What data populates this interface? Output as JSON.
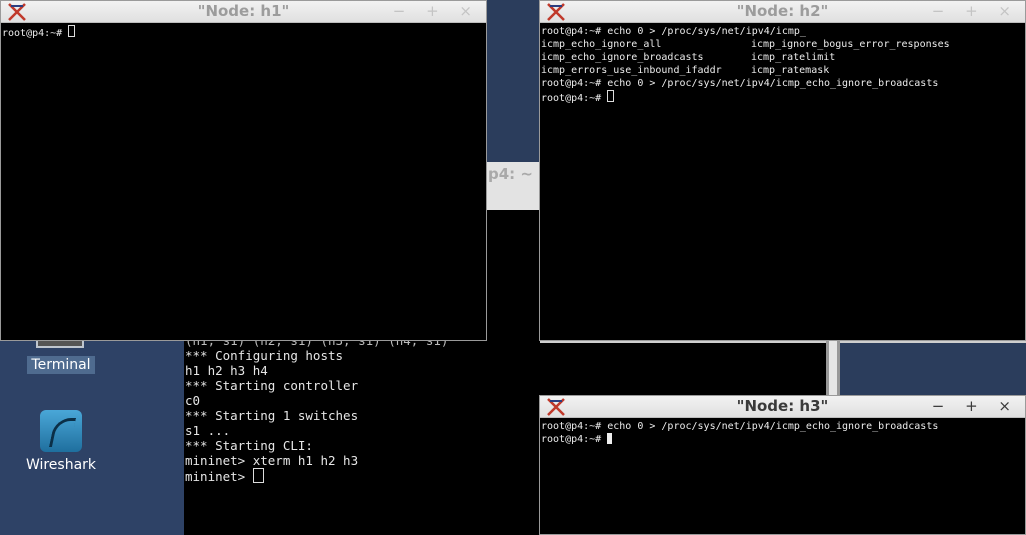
{
  "desktop": {
    "terminal_icon_label": "Terminal",
    "wireshark_icon_label": "Wireshark"
  },
  "background_window": {
    "title_partial": "p4: ~"
  },
  "mininet_terminal": {
    "lines": [
      "(h1, s1) (h2, s1) (h3, s1) (h4, s1)",
      "*** Configuring hosts",
      "h1 h2 h3 h4",
      "*** Starting controller",
      "c0",
      "*** Starting 1 switches",
      "s1 ...",
      "*** Starting CLI:",
      "mininet> xterm h1 h2 h3"
    ],
    "prompt": "mininet> "
  },
  "windows": {
    "h1": {
      "title": "\"Node: h1\"",
      "buttons": "− + ×",
      "prompt": "root@p4:~# "
    },
    "h2": {
      "title": "\"Node: h2\"",
      "buttons": "− + ×",
      "line1": "root@p4:~# echo 0 > /proc/sys/net/ipv4/icmp_",
      "completions": [
        [
          "icmp_echo_ignore_all",
          "icmp_ignore_bogus_error_responses"
        ],
        [
          "icmp_echo_ignore_broadcasts",
          "icmp_ratelimit"
        ],
        [
          "icmp_errors_use_inbound_ifaddr",
          "icmp_ratemask"
        ]
      ],
      "line2": "root@p4:~# echo 0 > /proc/sys/net/ipv4/icmp_echo_ignore_broadcasts",
      "prompt": "root@p4:~# "
    },
    "h3": {
      "title": "\"Node: h3\"",
      "buttons": "− + ×",
      "line1": "root@p4:~# echo 0 > /proc/sys/net/ipv4/icmp_echo_ignore_broadcasts",
      "prompt": "root@p4:~# "
    }
  },
  "colors": {
    "desktop_bg": "#2b3d5c",
    "terminal_bg": "#000000",
    "titlebar_bg": "#e6e6e6",
    "xterm_logo": "#c0392b"
  }
}
